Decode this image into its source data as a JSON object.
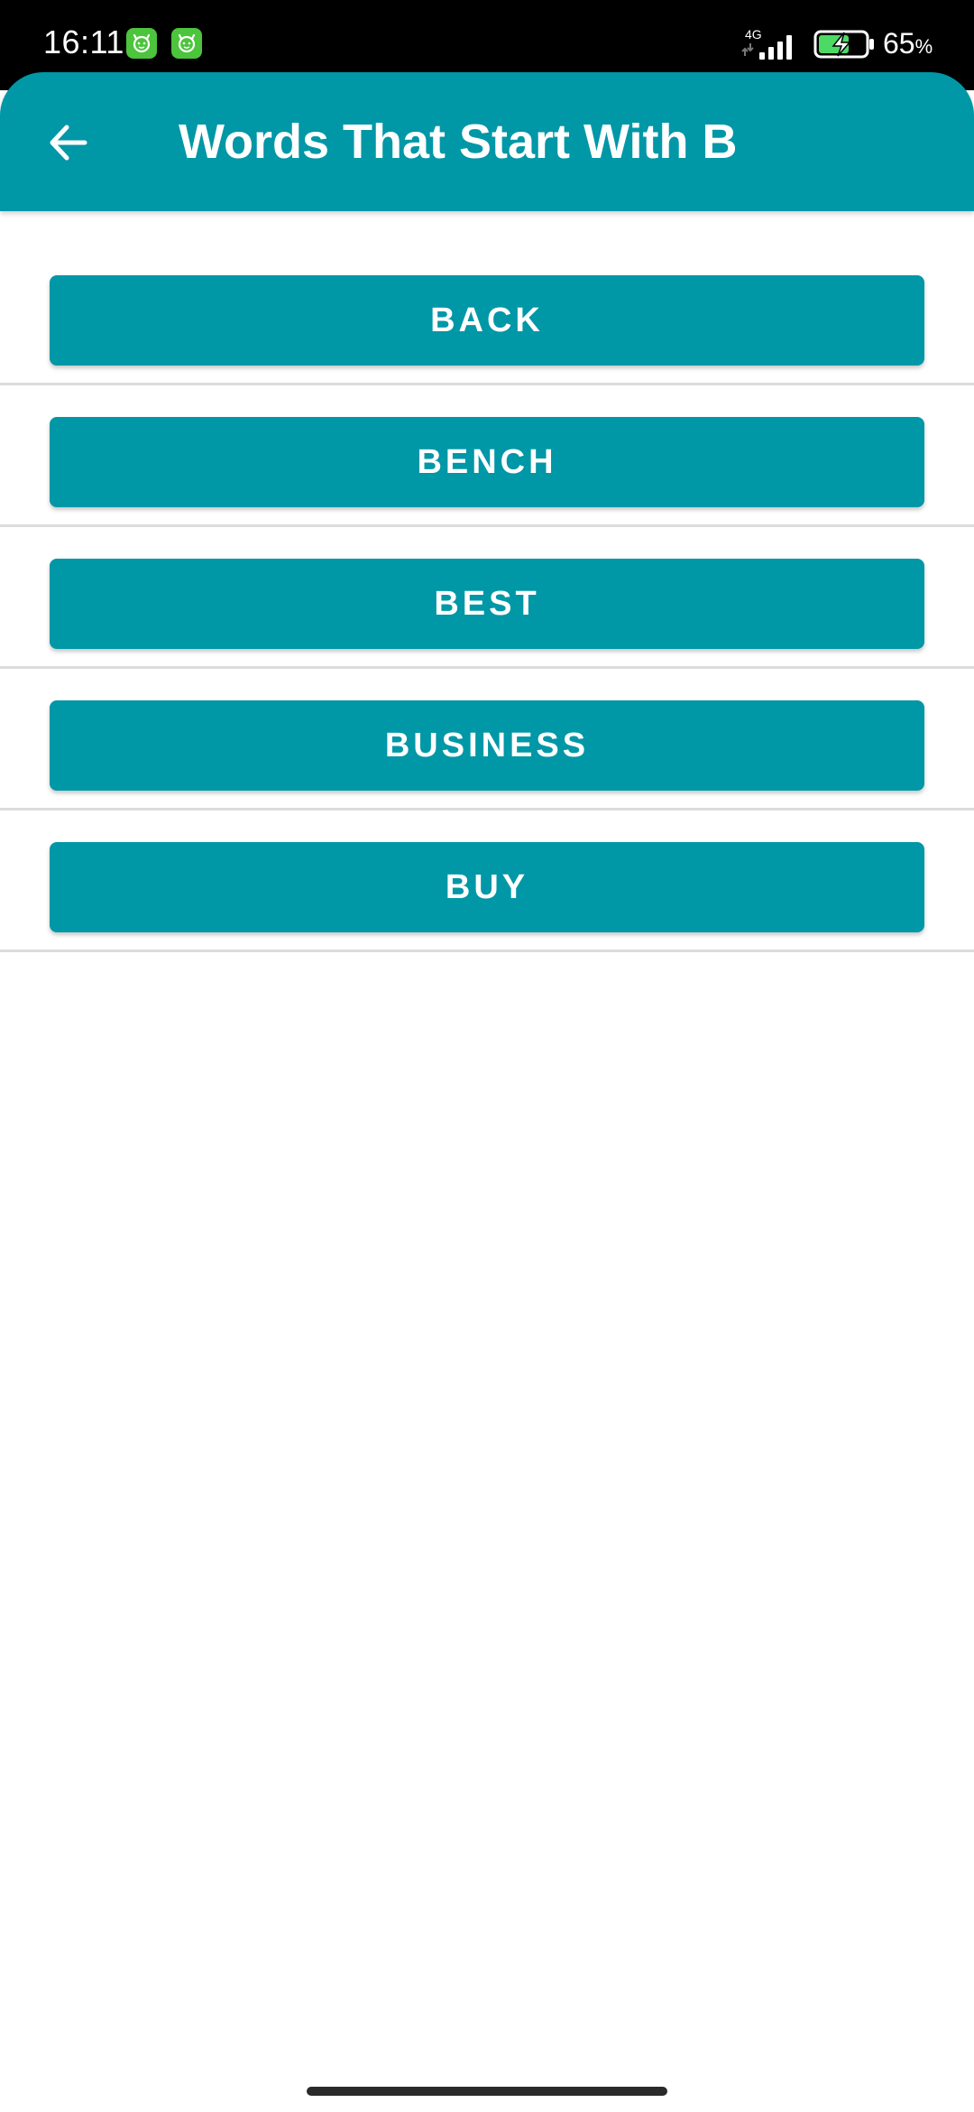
{
  "status_bar": {
    "time": "16:11",
    "network_type": "4G",
    "battery_level": "65",
    "battery_unit": "%",
    "notification_icons": [
      "app-notification-icon",
      "app-notification-icon"
    ]
  },
  "app_bar": {
    "title": "Words That Start With B",
    "back_icon": "arrow-back-icon",
    "color": "#0097a7"
  },
  "words": [
    {
      "label": "BACK"
    },
    {
      "label": "BENCH"
    },
    {
      "label": "BEST"
    },
    {
      "label": "BUSINESS"
    },
    {
      "label": "BUY"
    }
  ],
  "colors": {
    "accent": "#0097a7",
    "status_bar": "#000000",
    "battery_charging": "#4cd964",
    "divider": "#dcdcdc"
  }
}
